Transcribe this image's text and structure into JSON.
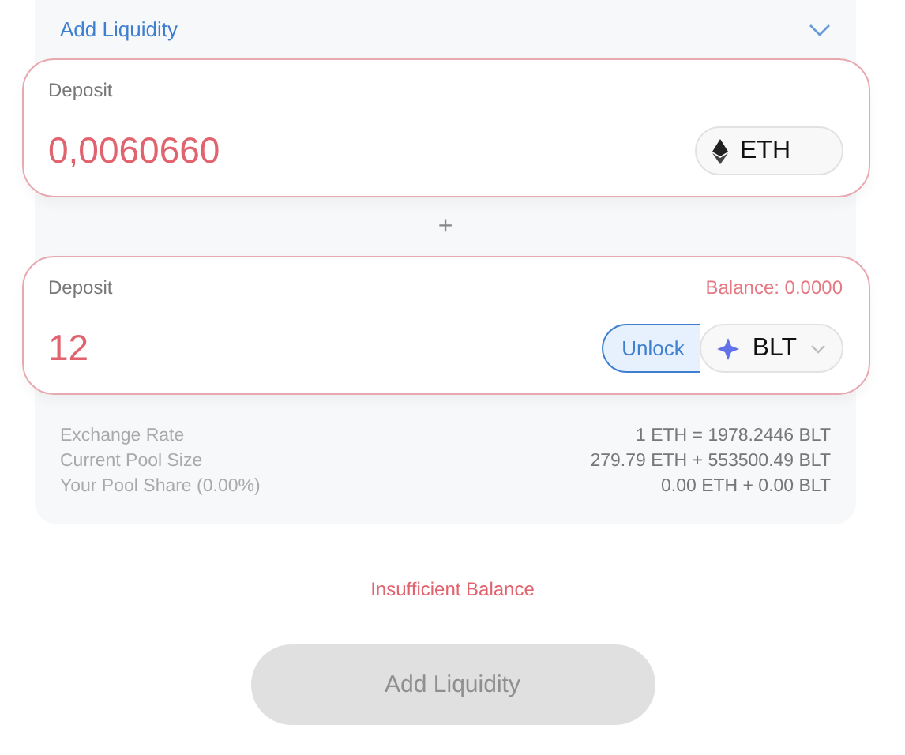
{
  "header": {
    "title": "Add Liquidity"
  },
  "deposits": [
    {
      "label": "Deposit",
      "value": "0,0060660",
      "token": "ETH",
      "kind": "eth"
    },
    {
      "label": "Deposit",
      "balance": "Balance: 0.0000",
      "value": "12",
      "unlock": "Unlock",
      "token": "BLT",
      "kind": "blt"
    }
  ],
  "separator": "+",
  "info": [
    {
      "label": "Exchange Rate",
      "value": "1 ETH = 1978.2446 BLT"
    },
    {
      "label": "Current Pool Size",
      "value": "279.79 ETH + 553500.49 BLT"
    },
    {
      "label": "Your Pool Share (0.00%)",
      "value": "0.00 ETH + 0.00 BLT"
    }
  ],
  "error": "Insufficient Balance",
  "submit": {
    "label": "Add Liquidity",
    "disabled": true
  }
}
